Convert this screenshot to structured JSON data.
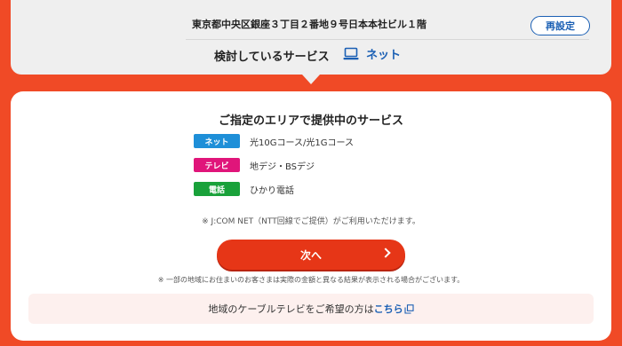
{
  "header": {
    "address": "東京都中央区銀座３丁目２番地９号日本本社ビル１階",
    "reset_label": "再設定",
    "considering_label": "検討しているサービス",
    "selected_service": "ネット",
    "selected_icon": "laptop-icon"
  },
  "card": {
    "title": "ご指定のエリアで提供中のサービス",
    "services": [
      {
        "badge": "ネット",
        "badge_color": "#1e8fd8",
        "text": "光10Gコース/光1Gコース"
      },
      {
        "badge": "テレビ",
        "badge_color": "#e0157a",
        "text": "地デジ・BSデジ"
      },
      {
        "badge": "電話",
        "badge_color": "#19a13a",
        "text": "ひかり電話"
      }
    ],
    "note_service": "※ J:COM NET（NTT回線でご提供）がご利用いただけます。",
    "next_label": "次へ",
    "note_disclaimer": "※ 一部の地域にお住まいのお客さまは実際の金額と異なる結果が表示される場合がございます。",
    "local_cable_text": "地域のケーブルテレビをご希望の方は",
    "local_cable_link": "こちら"
  },
  "colors": {
    "background": "#f04a26",
    "accent_blue": "#1a5fb4",
    "next_button": "#e63617"
  }
}
